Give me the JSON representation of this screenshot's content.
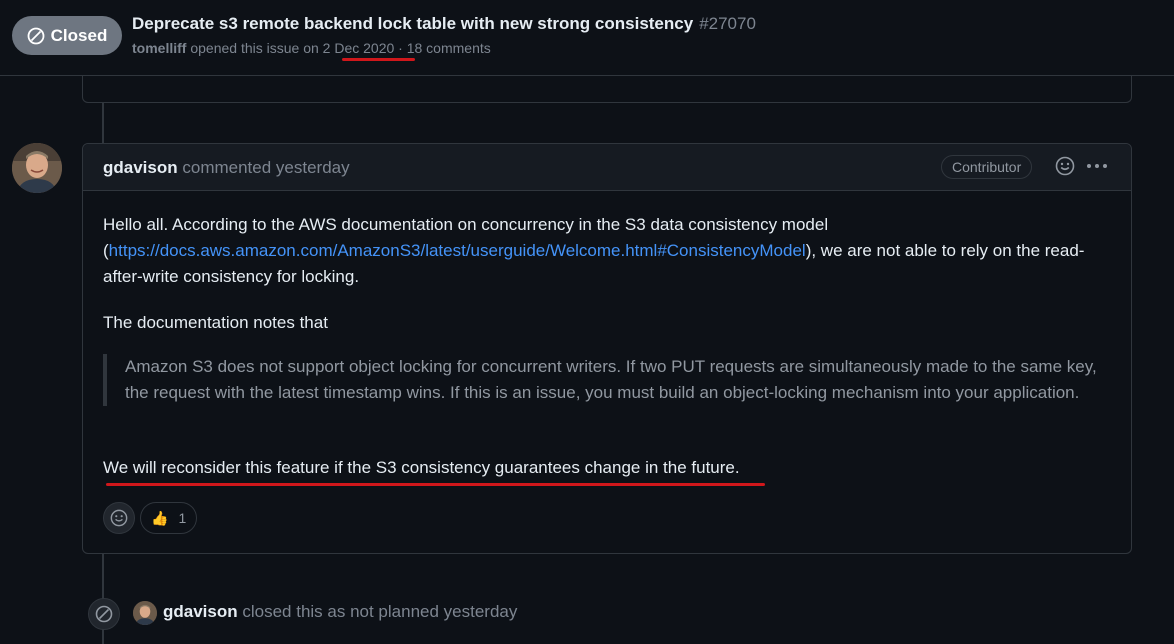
{
  "header": {
    "state_label": "Closed",
    "title": "Deprecate s3 remote backend lock table with new strong consistency",
    "number": "#27070",
    "author": "tomelliff",
    "opened_text": "opened this issue on",
    "date": "2 Dec 2020",
    "comments": "· 18 comments"
  },
  "comment": {
    "author": "gdavison",
    "action": "commented yesterday",
    "role_badge": "Contributor",
    "p1_before": "Hello all. According to the AWS documentation on concurrency in the S3 data consistency model (",
    "p1_link": "https://docs.aws.amazon.com/AmazonS3/latest/userguide/Welcome.html#ConsistencyModel",
    "p1_after": "), we are not able to rely on the read-after-write consistency for locking.",
    "p2": "The documentation notes that",
    "quote": "Amazon S3 does not support object locking for concurrent writers. If two PUT requests are simultaneously made to the same key, the request with the latest timestamp wins. If this is an issue, you must build an object-locking mechanism into your application.",
    "p3": "We will reconsider this feature if the S3 consistency guarantees change in the future.",
    "reaction_emoji": "👍",
    "reaction_count": "1"
  },
  "event": {
    "author": "gdavison",
    "text": "closed this as not planned yesterday"
  },
  "colors": {
    "background": "#0d1117",
    "border": "#30363d",
    "link": "#4493f8",
    "annotation_red": "#d0171b",
    "badge_gray": "#6e7681"
  },
  "icons": [
    "closed-circle-icon",
    "smiley-icon",
    "kebab-icon",
    "skip-circle-icon"
  ]
}
